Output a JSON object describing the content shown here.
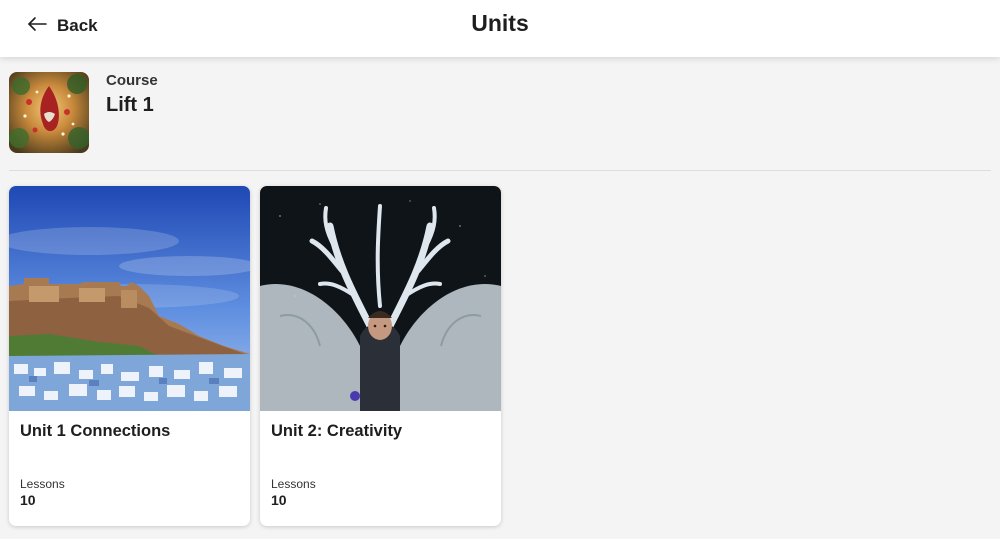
{
  "header": {
    "back_label": "Back",
    "title": "Units"
  },
  "course": {
    "eyebrow": "Course",
    "name": "Lift 1"
  },
  "units": [
    {
      "title": "Unit 1 Connections",
      "lessons_label": "Lessons",
      "lessons_count": "10"
    },
    {
      "title": "Unit 2: Creativity",
      "lessons_label": "Lessons",
      "lessons_count": "10"
    }
  ],
  "icons": {
    "back": "arrow-left-icon"
  }
}
